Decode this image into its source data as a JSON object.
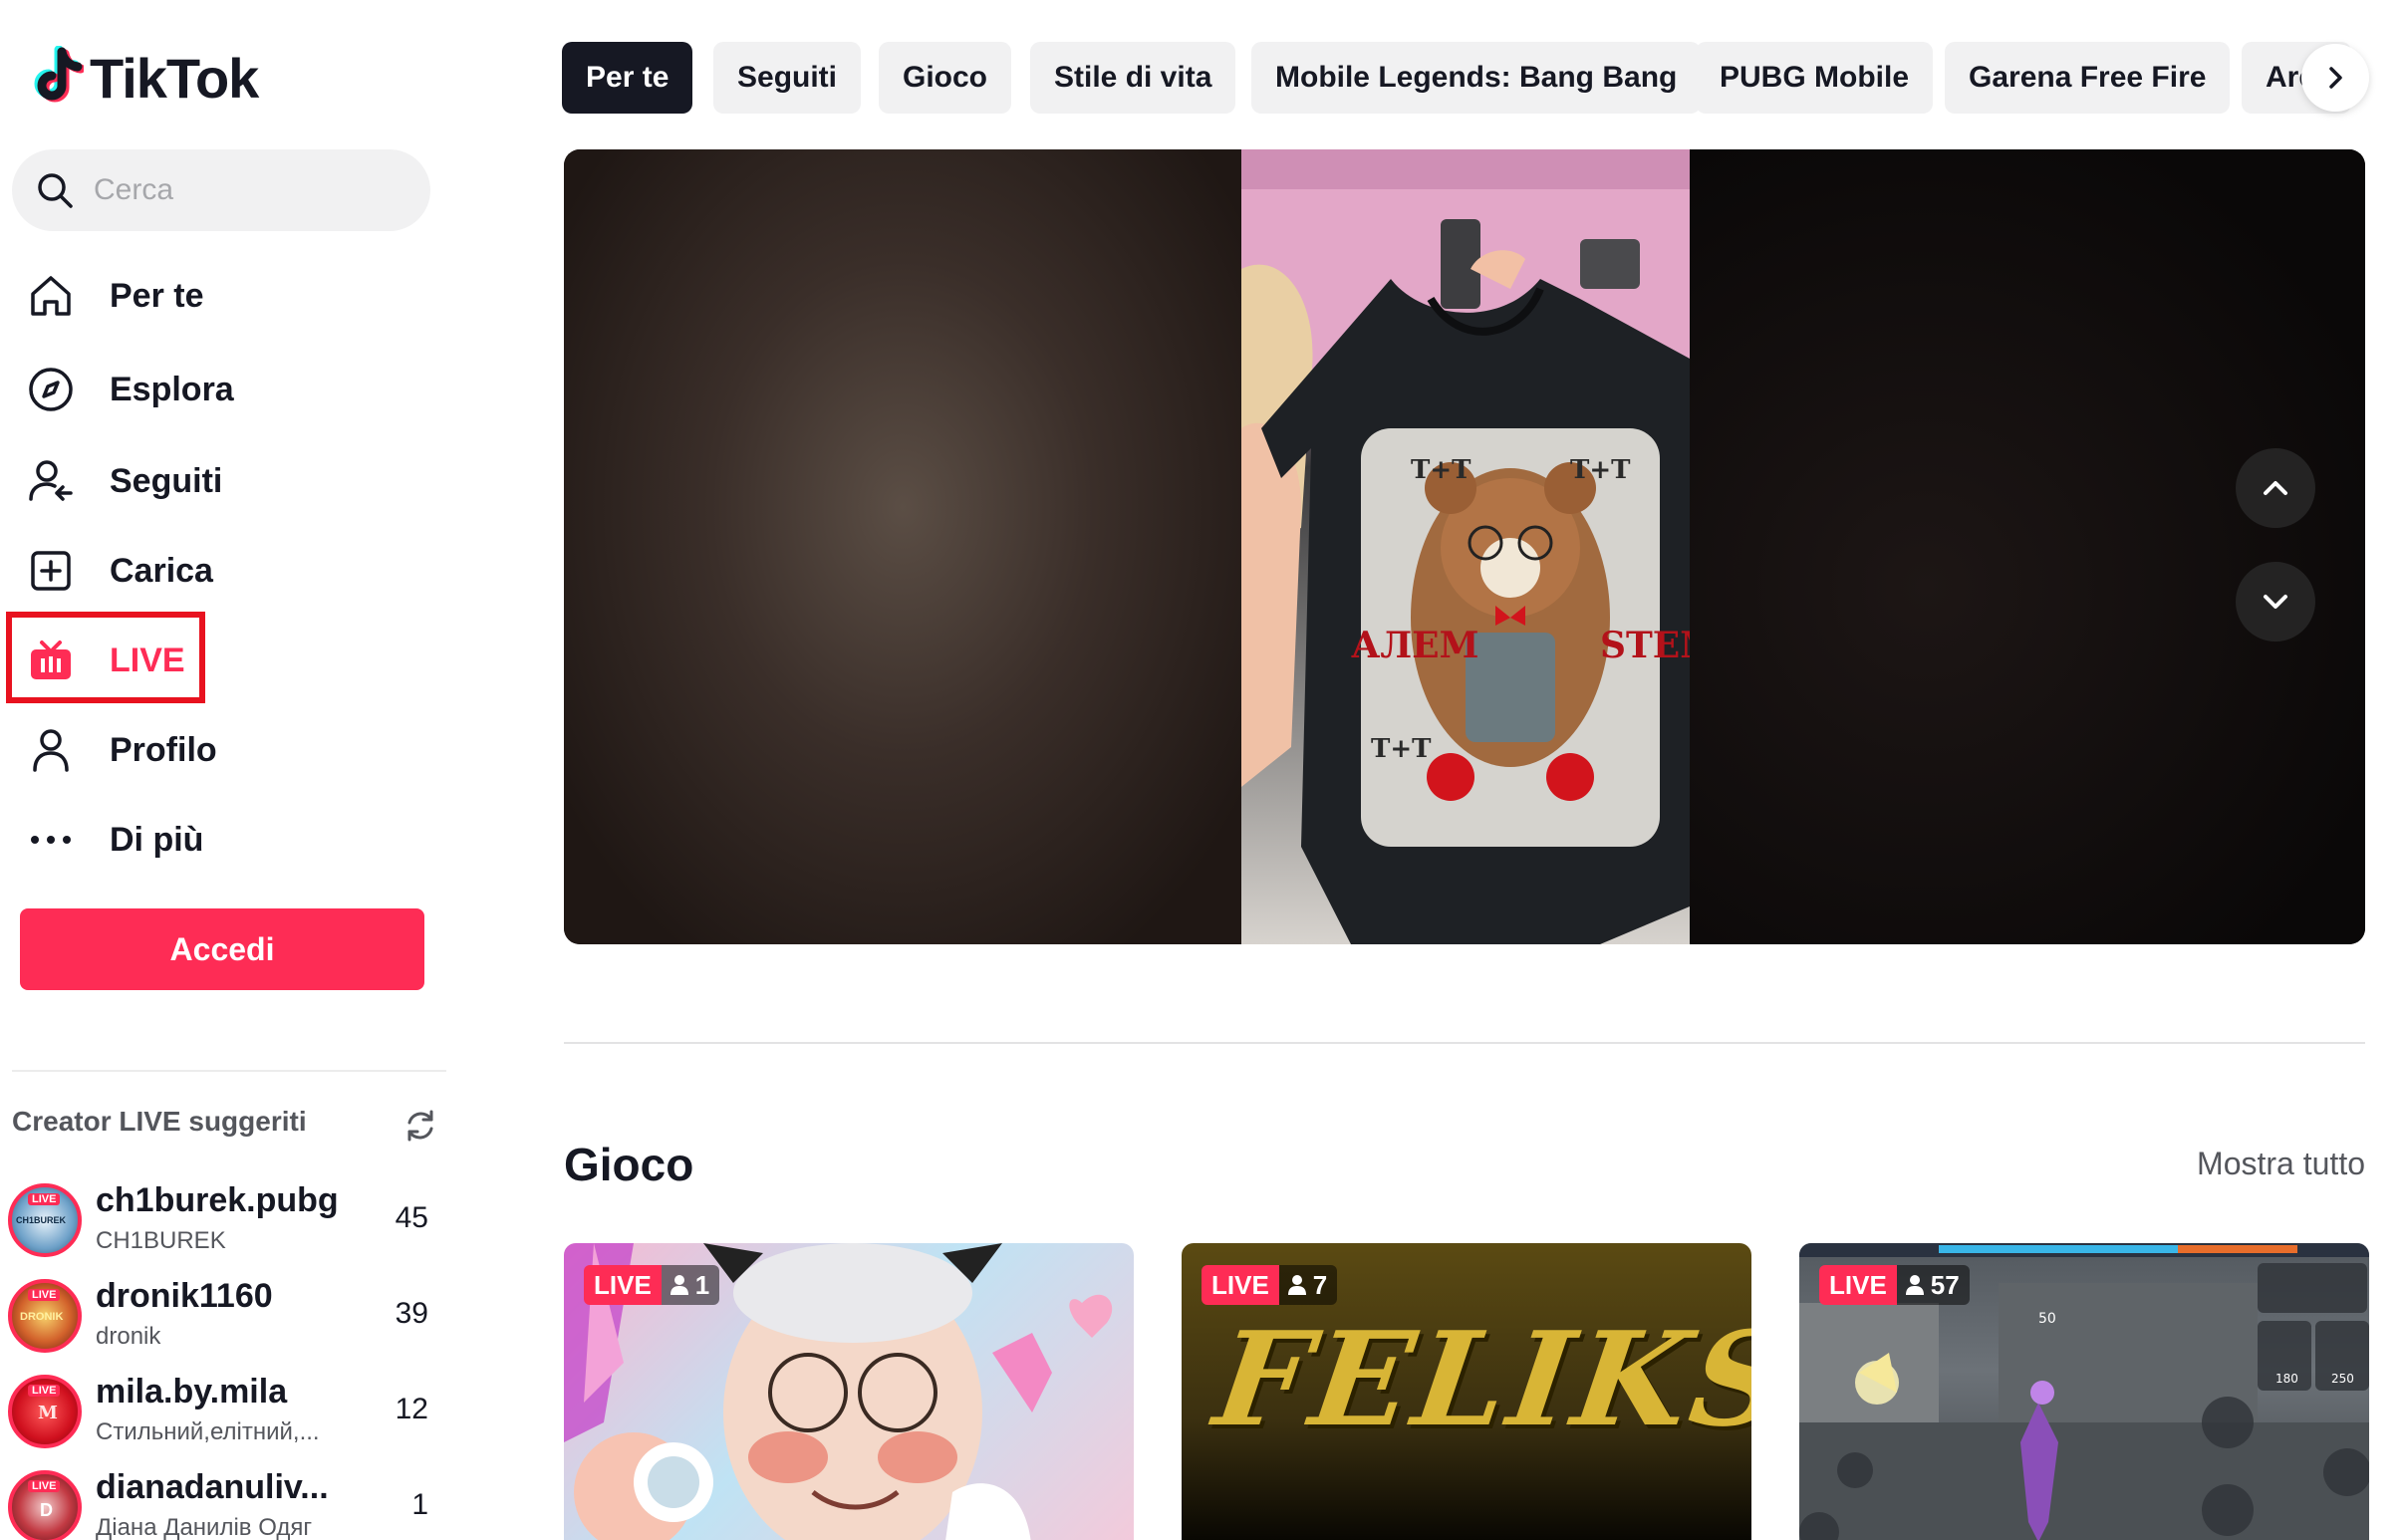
{
  "brand": {
    "name": "TikTok"
  },
  "search": {
    "placeholder": "Cerca"
  },
  "nav": {
    "items": [
      {
        "label": "Per te",
        "icon": "home-icon"
      },
      {
        "label": "Esplora",
        "icon": "compass-icon"
      },
      {
        "label": "Seguiti",
        "icon": "following-icon"
      },
      {
        "label": "Carica",
        "icon": "upload-icon"
      },
      {
        "label": "LIVE",
        "icon": "live-tv-icon",
        "active": true
      },
      {
        "label": "Profilo",
        "icon": "profile-icon"
      },
      {
        "label": "Di più",
        "icon": "more-icon"
      }
    ]
  },
  "login": {
    "label": "Accedi"
  },
  "suggested": {
    "title": "Creator LIVE suggeriti",
    "creators": [
      {
        "name": "ch1burek.pubg",
        "subtitle": "CH1BUREK",
        "viewers": "45",
        "avatar_text": "CH1BUREK"
      },
      {
        "name": "dronik1160",
        "subtitle": "dronik",
        "viewers": "39",
        "avatar_text": "DRONIK"
      },
      {
        "name": "mila.by.mila",
        "subtitle": "Стильний,елітний,...",
        "viewers": "12",
        "avatar_text": "M"
      },
      {
        "name": "dianadanuliv...",
        "subtitle": "Діана Данилів Одяг",
        "viewers": "1",
        "avatar_text": "D"
      }
    ],
    "live_tag": "LIVE"
  },
  "categories": {
    "tabs": [
      "Per te",
      "Seguiti",
      "Gioco",
      "Stile di vita",
      "Mobile Legends: Bang Bang",
      "PUBG Mobile",
      "Garena Free Fire",
      "Are"
    ],
    "active_index": 0
  },
  "player": {
    "t_shirt_print": [
      "T+T",
      "T+T",
      "T+T",
      "АЛЕМ",
      "STEM"
    ]
  },
  "section": {
    "title": "Gioco",
    "show_all": "Mostra tutto",
    "cards": [
      {
        "live": "LIVE",
        "viewers": "1"
      },
      {
        "live": "LIVE",
        "viewers": "7",
        "overlay_text": "FELIKS"
      },
      {
        "live": "LIVE",
        "viewers": "57",
        "hud_text": [
          "50",
          "180",
          "250"
        ]
      }
    ]
  },
  "colors": {
    "accent": "#fe2c55",
    "dark": "#161823",
    "chip_bg": "#f1f1f2",
    "highlight_box": "#e8121f"
  }
}
